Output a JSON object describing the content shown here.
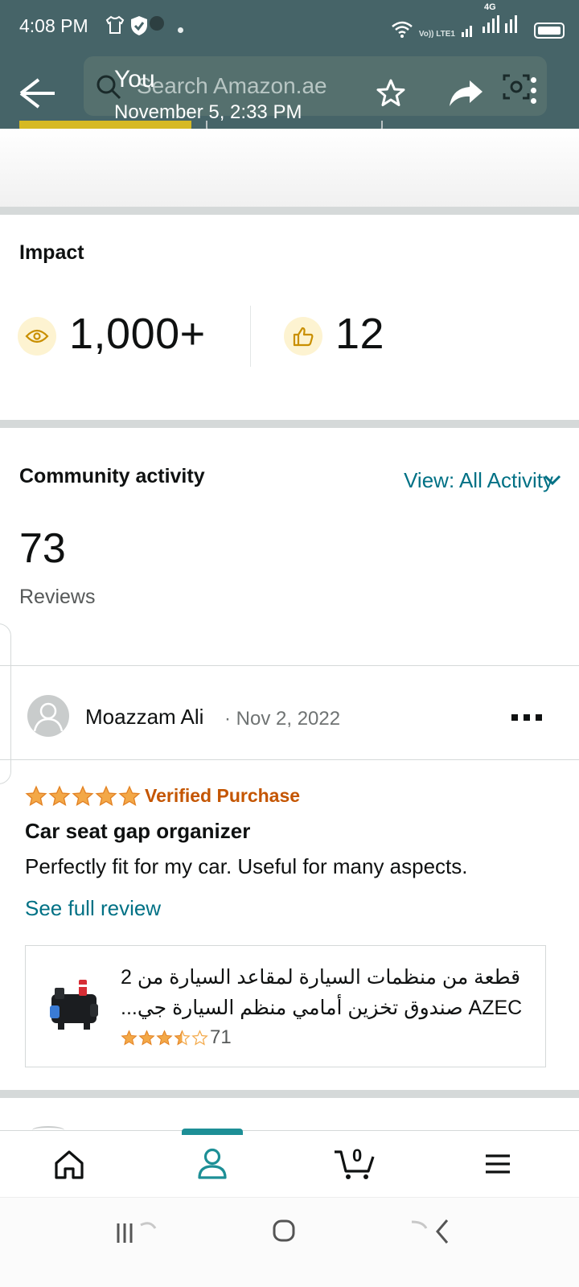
{
  "status_bar": {
    "time": "4:08 PM",
    "network_label": "Vo)) LTE1",
    "network_type": "4G"
  },
  "viewer": {
    "title": "You",
    "date": "November 5, 2:33 PM",
    "ghost_search_placeholder": "Search Amazon.ae"
  },
  "impact": {
    "heading": "Impact",
    "views": "1,000+",
    "likes": "12"
  },
  "community": {
    "heading": "Community activity",
    "view_filter": "View: All Activity",
    "count": "73",
    "count_label": "Reviews"
  },
  "review": {
    "reviewer": "Moazzam Ali",
    "date": "· Nov 2, 2022",
    "rating": 5,
    "verified": "Verified Purchase",
    "title": "Car seat gap organizer",
    "body": "Perfectly fit for my car. Useful for many aspects.",
    "see_full": "See full review",
    "product": {
      "title_line1": "قطعة من منظمات السيارة لمقاعد السيارة من 2",
      "title_line2": "AZEC صندوق تخزين أمامي منظم السيارة جي...",
      "rating": 3.5,
      "rating_count": "71"
    }
  },
  "bottom_nav": {
    "items": [
      "home-icon",
      "profile-icon",
      "cart-icon",
      "menu-icon"
    ],
    "cart_count": "0",
    "active": "profile"
  },
  "colors": {
    "link": "#007185",
    "star": "#f3a847",
    "verified": "#c45500",
    "accent": "#1d8f96"
  }
}
